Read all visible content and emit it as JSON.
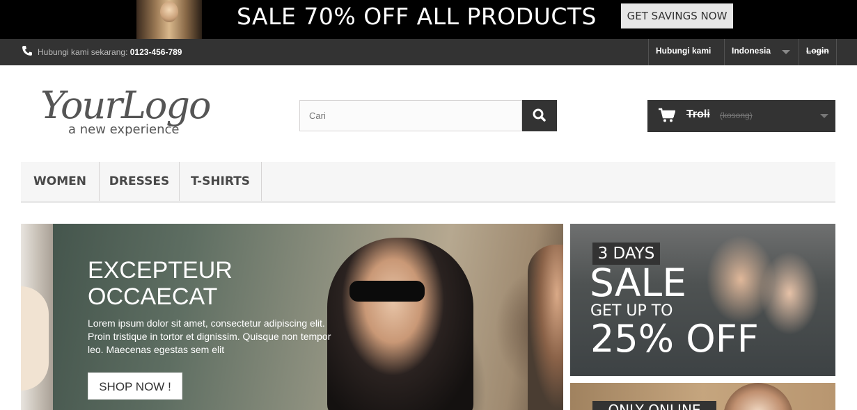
{
  "promo": {
    "headline": "SALE 70% OFF ALL PRODUCTS",
    "button_label": "GET SAVINGS NOW"
  },
  "topbar": {
    "contact_label": "Hubungi kami sekarang:",
    "contact_phone": "0123-456-789",
    "nav_contact": "Hubungi kami",
    "language": "Indonesia",
    "login": "Login"
  },
  "header": {
    "logo_main": "YourLogo",
    "logo_tagline": "a new experience",
    "search_placeholder": "Cari",
    "cart_label": "Troli",
    "cart_status": "(kosong)"
  },
  "menu": {
    "items": [
      "WOMEN",
      "DRESSES",
      "T-SHIRTS"
    ]
  },
  "hero": {
    "title_line1": "EXCEPTEUR",
    "title_line2": "OCCAECAT",
    "body": "Lorem ipsum dolor sit amet, consectetur adipiscing elit. Proin tristique in tortor et dignissim. Quisque non tempor leo. Maecenas egestas sem elit",
    "button_label": "SHOP NOW !"
  },
  "banners": [
    {
      "tag": "3 DAYS",
      "headline": "SALE",
      "subline": "GET UP TO",
      "value": "25% OFF"
    },
    {
      "tag": "ONLY ONLINE"
    }
  ],
  "colors": {
    "dark": "#333333",
    "promo_bg": "#000000",
    "menu_bg": "#f6f6f6"
  },
  "icons": [
    "phone-icon",
    "search-icon",
    "cart-icon",
    "chevron-down-icon"
  ]
}
